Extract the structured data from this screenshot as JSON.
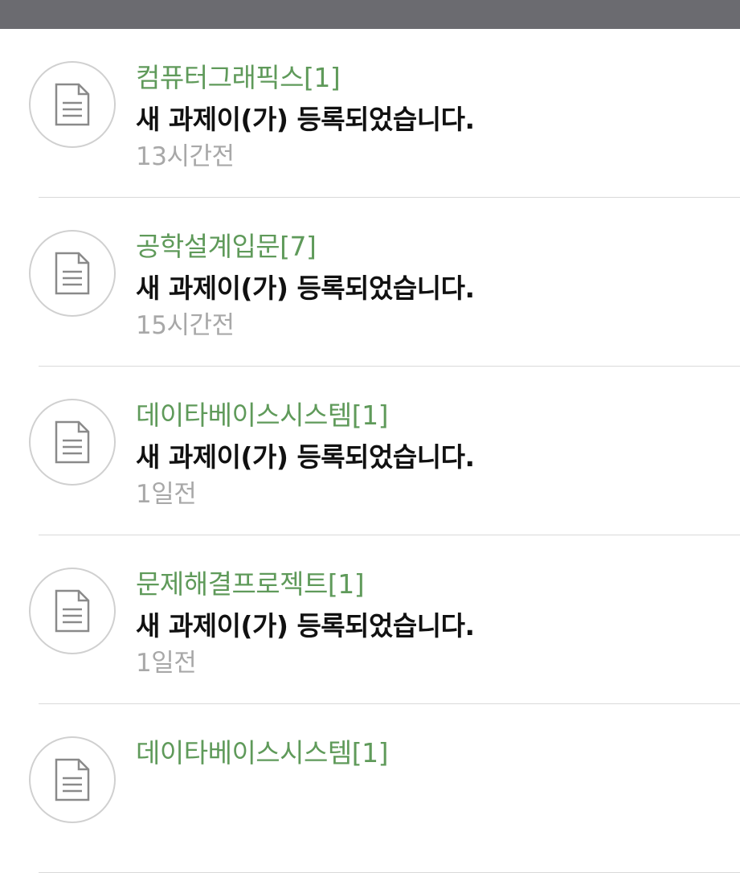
{
  "notifications": [
    {
      "course": "컴퓨터그래픽스[1]",
      "message": "새 과제이(가) 등록되었습니다.",
      "time": "13시간전",
      "icon": "document-icon"
    },
    {
      "course": "공학설계입문[7]",
      "message": "새 과제이(가) 등록되었습니다.",
      "time": "15시간전",
      "icon": "document-icon"
    },
    {
      "course": "데이타베이스시스템[1]",
      "message": "새 과제이(가) 등록되었습니다.",
      "time": "1일전",
      "icon": "document-icon"
    },
    {
      "course": "문제해결프로젝트[1]",
      "message": "새 과제이(가) 등록되었습니다.",
      "time": "1일전",
      "icon": "document-icon"
    },
    {
      "course": "데이타베이스시스템[1]",
      "message": "",
      "time": "",
      "icon": "document-icon"
    }
  ],
  "colors": {
    "topbar": "#6b6b70",
    "course": "#5f9a5a",
    "message": "#111111",
    "time": "#a8a8a8"
  }
}
